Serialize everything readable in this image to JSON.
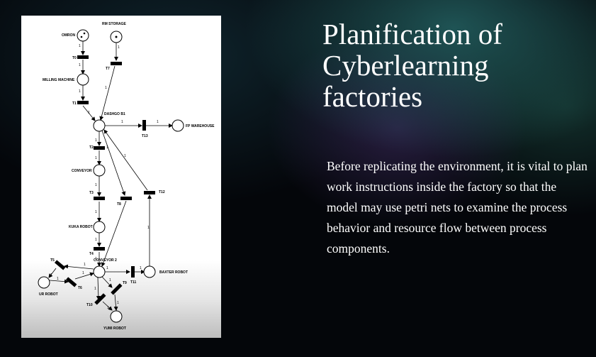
{
  "slide": {
    "title": "Planification of Cyberlearning factories",
    "body": "Before replicating the environment, it is vital to plan work instructions inside the factory so that the model may use petri nets to examine the process behavior and resource flow between process components."
  },
  "petri_net": {
    "places": {
      "omron": "OMRON",
      "rm_storage": "RM STORAGE",
      "milling_machine": "MILLING MACHINE",
      "dashgo_b1": "DASHGO B1",
      "fp_warehouse": "FP WAREHOUSE",
      "conveyor": "CONVEYOR",
      "kuka_robot": "KUKA ROBOT",
      "conveyor_2": "CONVEYOR 2",
      "baxter_robot": "BAXTER ROBOT",
      "ur_robot": "UR ROBOT",
      "yumi_robot": "YUMI ROBOT"
    },
    "transitions": {
      "t0": "T0",
      "t1": "T1",
      "t2": "T2",
      "t3": "T3",
      "t4": "T4",
      "t5": "T5",
      "t6": "T6",
      "t7": "T7",
      "t8": "T8",
      "t9": "T9",
      "t10": "T10",
      "t11": "T11",
      "t12": "T12",
      "t13": "T13"
    },
    "arc_weight": "1"
  },
  "colors": {
    "text": "#ffffff",
    "diagram_bg": "#ffffff",
    "ink": "#000000"
  }
}
